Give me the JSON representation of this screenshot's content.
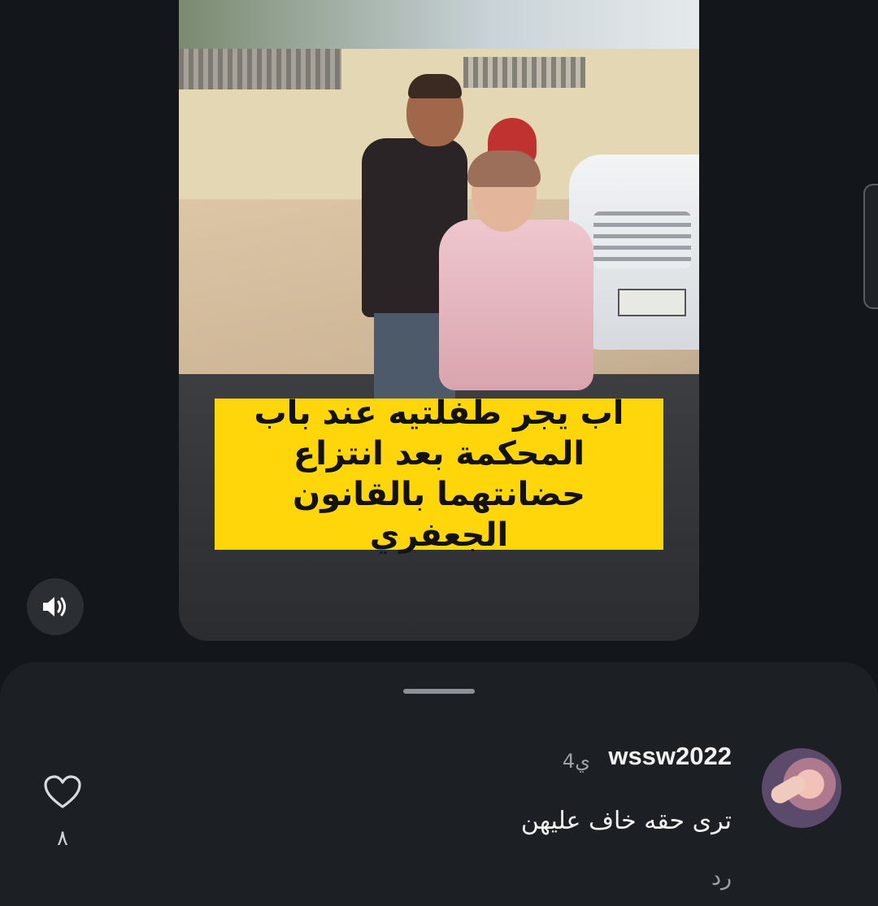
{
  "video": {
    "caption": "اب يجر طفلتيه عند باب المحكمة بعد انتزاع حضانتهما بالقانون الجعفري"
  },
  "controls": {
    "sound_icon": "speaker-icon"
  },
  "comments": {
    "items": [
      {
        "username": "wssw2022",
        "time": "4ي",
        "text": "ترى حقه خاف عليهن",
        "reply_label": "رد",
        "like_count": "٨",
        "like_icon": "heart-outline-icon"
      }
    ]
  }
}
